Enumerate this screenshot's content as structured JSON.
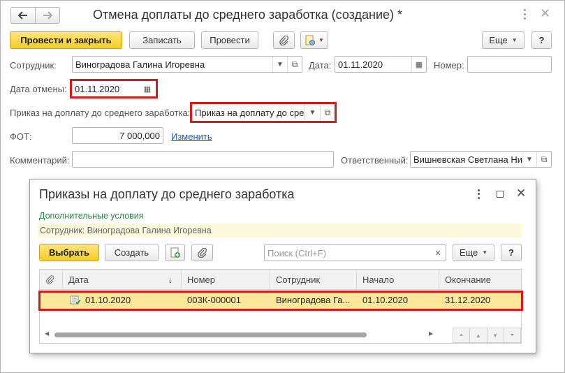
{
  "window": {
    "title": "Отмена доплаты до среднего заработка (создание) *"
  },
  "toolbar": {
    "post_close": "Провести и закрыть",
    "write": "Записать",
    "post": "Провести",
    "more": "Еще",
    "help": "?"
  },
  "form": {
    "employee_label": "Сотрудник:",
    "employee_value": "Виноградова Галина Игоревна",
    "date_label": "Дата:",
    "date_value": "01.11.2020",
    "number_label": "Номер:",
    "number_value": "",
    "cancel_date_label": "Дата отмены:",
    "cancel_date_value": "01.11.2020",
    "order_label": "Приказ на доплату до среднего заработка:",
    "order_value": "Приказ на доплату до сре",
    "fot_label": "ФОТ:",
    "fot_value": "7 000,000",
    "change_link": "Изменить",
    "comment_label": "Комментарий:",
    "comment_value": "",
    "responsible_label": "Ответственный:",
    "responsible_value": "Вишневская Светлана Ни"
  },
  "dialog": {
    "title": "Приказы на доплату до среднего заработка",
    "extra_conditions": "Дополнительные условия",
    "filter_text": "Сотрудник: Виноградова Галина Игоревна",
    "select": "Выбрать",
    "create": "Создать",
    "search_placeholder": "Поиск (Ctrl+F)",
    "more": "Еще",
    "help": "?",
    "columns": [
      "Дата",
      "Номер",
      "Сотрудник",
      "Начало",
      "Окончание"
    ],
    "rows": [
      {
        "date": "01.10.2020",
        "number": "003К-000001",
        "employee": "Виноградова Га...",
        "start": "01.10.2020",
        "end": "31.12.2020"
      }
    ]
  }
}
